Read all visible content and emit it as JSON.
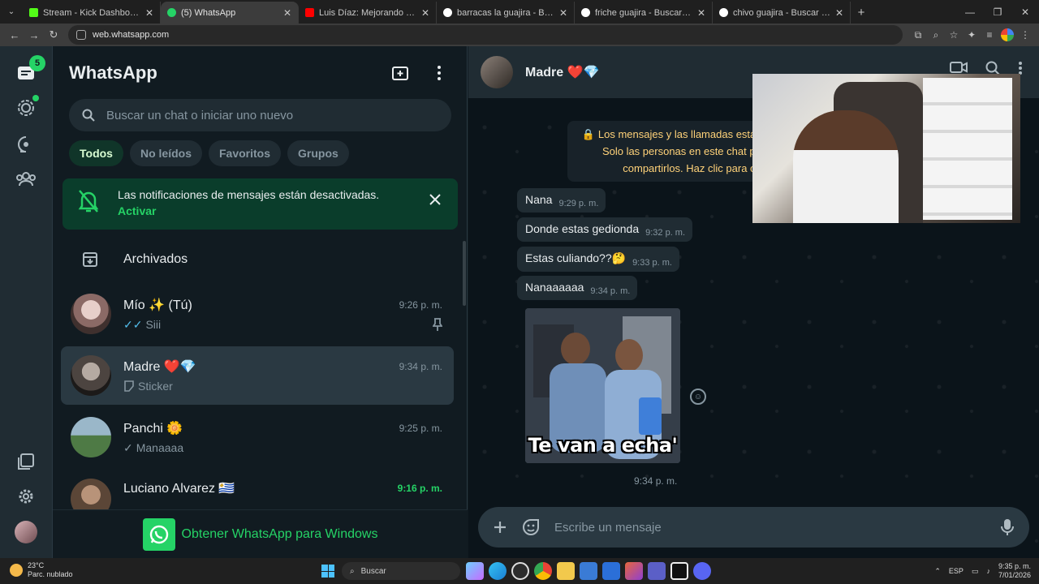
{
  "browser": {
    "tabs": [
      {
        "title": "Stream - Kick Dashboard",
        "color": "#53fc18",
        "active": false
      },
      {
        "title": "(5) WhatsApp",
        "color": "#25d366",
        "active": true
      },
      {
        "title": "Luis Díaz: Mejorando Nuestro I",
        "color": "#ff0000",
        "active": false
      },
      {
        "title": "barracas la guajira - Buscar con",
        "color": "#4285f4",
        "active": false
      },
      {
        "title": "friche guajira - Buscar con Goo",
        "color": "#4285f4",
        "active": false
      },
      {
        "title": "chivo guajira - Buscar con Goo",
        "color": "#4285f4",
        "active": false
      }
    ],
    "url": "web.whatsapp.com"
  },
  "rail": {
    "chats_badge": "5"
  },
  "chatlist": {
    "title": "WhatsApp",
    "search_placeholder": "Buscar un chat o iniciar uno nuevo",
    "filters": [
      "Todos",
      "No leídos",
      "Favoritos",
      "Grupos"
    ],
    "notification": {
      "text": "Las notificaciones de mensajes están desactivadas.",
      "action": "Activar"
    },
    "archived_label": "Archivados",
    "chats": [
      {
        "name": "Mío ✨ (Tú)",
        "time": "9:26 p. m.",
        "preview": "Siii",
        "ticks": "✓✓",
        "pinned": true,
        "avatar": "#c9a19b"
      },
      {
        "name": "Madre ❤️💎",
        "time": "9:34 p. m.",
        "preview": "Sticker",
        "ticks": "",
        "pinned": false,
        "avatar": "#6f6660"
      },
      {
        "name": "Panchi 🌼",
        "time": "9:25 p. m.",
        "preview": "Manaaaa",
        "ticks": "✓",
        "pinned": false,
        "avatar": "#5c7a5a"
      },
      {
        "name": "Luciano Alvarez 🇺🇾",
        "time": "9:16 p. m.",
        "preview": "",
        "ticks": "",
        "pinned": false,
        "avatar": "#7a6a5e",
        "unread": true
      }
    ],
    "get_app_label": "Obtener WhatsApp para Windows"
  },
  "conversation": {
    "contact_name": "Madre ❤️💎",
    "encryption_notice": "Los mensajes y las llamadas están cifrados de extremo a extremo. Solo las personas en este chat pueden leerlos, escucharlos o compartirlos. Haz clic para obtener más información.",
    "messages": [
      {
        "text": "Nana",
        "time": "9:29 p. m."
      },
      {
        "text": "Donde estas gedionda",
        "time": "9:32 p. m."
      },
      {
        "text": "Estas culiando??🤔",
        "time": "9:33 p. m."
      },
      {
        "text": "Nanaaaaaa",
        "time": "9:34 p. m."
      }
    ],
    "sticker": {
      "caption": "Te van a echa'",
      "time": "9:34 p. m."
    },
    "composer_placeholder": "Escribe un mensaje"
  },
  "taskbar": {
    "temperature": "23°C",
    "weather": "Parc. nublado",
    "search_label": "Buscar",
    "language": "ESP",
    "time": "9:35 p. m.",
    "date": "7/01/2026"
  }
}
